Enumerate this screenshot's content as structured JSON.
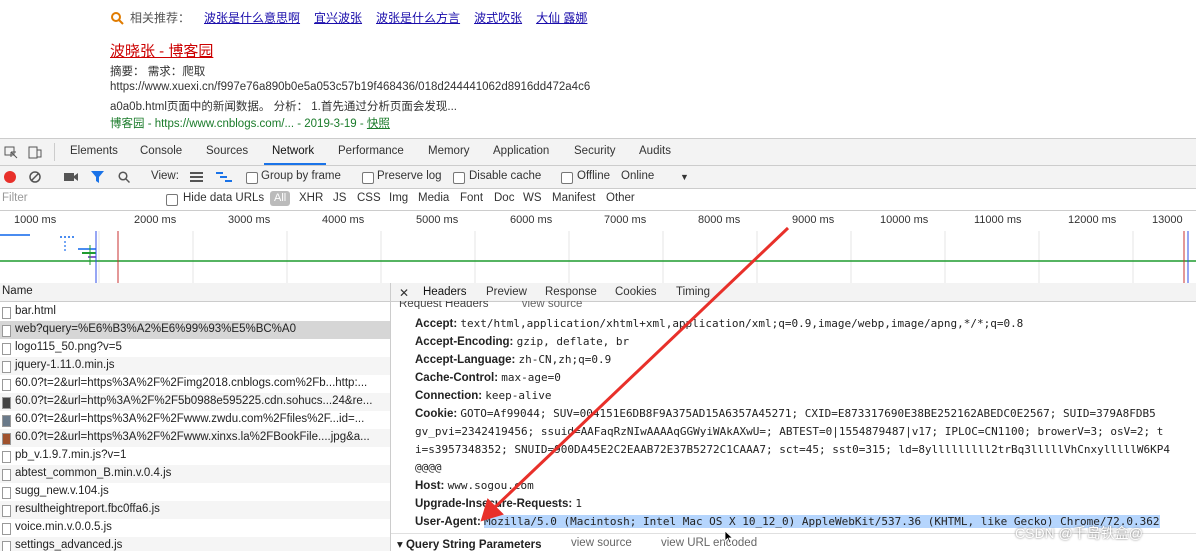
{
  "search": {
    "related_label": "相关推荐：",
    "related": [
      "波张是什么意思啊",
      "宜兴波张",
      "波张是什么方言",
      "波式吹张",
      "大仙 露娜"
    ],
    "result_title": "波晓张 - 博客园",
    "summary_line": "摘要：  需求：爬取",
    "url_line": "https://www.xuexi.cn/f997e76a890b0e5a053c57b19f468436/018d244441062d8916dd472a4c6",
    "desc_line": "a0a0b.html页面中的新闻数据。 分析： 1.首先通过分析页面会发现...",
    "source": "博客园 - https://www.cnblogs.com/... - 2019-3-19 - ",
    "snapshot": "快照"
  },
  "devtools": {
    "tabs": [
      "Elements",
      "Console",
      "Sources",
      "Network",
      "Performance",
      "Memory",
      "Application",
      "Security",
      "Audits"
    ],
    "active_tab": "Network",
    "toolbar": {
      "view_label": "View:",
      "group_by_frame": "Group by frame",
      "preserve_log": "Preserve log",
      "disable_cache": "Disable cache",
      "offline": "Offline",
      "throttle": "Online"
    },
    "filter": {
      "placeholder": "Filter",
      "hide_data_urls": "Hide data URLs",
      "all": "All",
      "types": [
        "XHR",
        "JS",
        "CSS",
        "Img",
        "Media",
        "Font",
        "Doc",
        "WS",
        "Manifest",
        "Other"
      ]
    },
    "timeline_ticks": [
      "1000 ms",
      "2000 ms",
      "3000 ms",
      "4000 ms",
      "5000 ms",
      "6000 ms",
      "7000 ms",
      "8000 ms",
      "9000 ms",
      "10000 ms",
      "11000 ms",
      "12000 ms",
      "13000"
    ],
    "name_header": "Name",
    "requests": [
      "bar.html",
      "web?query=%E6%B3%A2%E6%99%93%E5%BC%A0",
      "logo115_50.png?v=5",
      "jquery-1.11.0.min.js",
      "60.0?t=2&url=https%3A%2F%2Fimg2018.cnblogs.com%2Fb...http:...",
      "60.0?t=2&url=http%3A%2F%2F5b0988e595225.cdn.sohucs...24&re...",
      "60.0?t=2&url=https%3A%2F%2Fwww.zwdu.com%2Ffiles%2F...id=...",
      "60.0?t=2&url=https%3A%2F%2Fwww.xinxs.la%2FBookFile....jpg&a...",
      "pb_v.1.9.7.min.js?v=1",
      "abtest_common_B.min.v.0.4.js",
      "sugg_new.v.104.js",
      "resultheightreport.fbc0ffa6.js",
      "voice.min.v.0.0.5.js",
      "settings_advanced.js"
    ],
    "detail_tabs": [
      "Headers",
      "Preview",
      "Response",
      "Cookies",
      "Timing"
    ],
    "section_partial": "Request Headers",
    "view_source": "view source",
    "headers": [
      {
        "k": "Accept:",
        "v": "text/html,application/xhtml+xml,application/xml;q=0.9,image/webp,image/apng,*/*;q=0.8"
      },
      {
        "k": "Accept-Encoding:",
        "v": "gzip, deflate, br"
      },
      {
        "k": "Accept-Language:",
        "v": "zh-CN,zh;q=0.9"
      },
      {
        "k": "Cache-Control:",
        "v": "max-age=0"
      },
      {
        "k": "Connection:",
        "v": "keep-alive"
      },
      {
        "k": "Cookie:",
        "v": "GOTO=Af99044; SUV=004151E6DB8F9A375AD15A6357A45271; CXID=E873317690E38BE252162ABEDC0E2567; SUID=379A8FDB5"
      },
      {
        "k": "",
        "v": "gv_pvi=2342419456; ssuid=AAFaqRzNIwAAAAqGGWyiWAkAXwU=; ABTEST=0|1554879487|v17; IPLOC=CN1100; browerV=3; osV=2; t"
      },
      {
        "k": "",
        "v": "i=s3957348352; SNUID=900DA45E2C2EAAB72E37B5272C1CAAA7; sct=45; sst0=315; ld=8ylllllllll2trBq3lllllVhCnxylllllW6KP4"
      },
      {
        "k": "",
        "v": "@@@@"
      },
      {
        "k": "Host:",
        "v": "www.sogou.com"
      },
      {
        "k": "Upgrade-Insecure-Requests:",
        "v": "1"
      },
      {
        "k": "User-Agent:",
        "v": "Mozilla/5.0 (Macintosh; Intel Mac OS X 10_12_0) AppleWebKit/537.36 (KHTML, like Gecko) Chrome/72.0.362"
      }
    ],
    "query_section": "Query String Parameters",
    "view_url_encoded": "view URL encoded"
  },
  "watermark": "CSDN @千岛铁盒@",
  "colors": {
    "accent": "#1a73e8",
    "link": "#1a0dab",
    "title_red": "#cc0000",
    "arrow": "#e8302a",
    "highlight": "#b5d5fd"
  }
}
